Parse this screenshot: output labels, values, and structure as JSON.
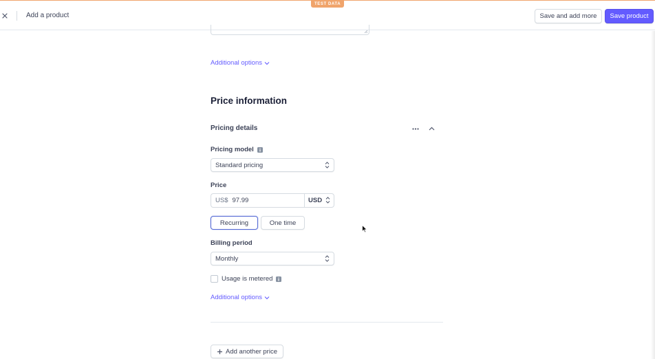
{
  "header": {
    "test_badge": "TEST DATA",
    "title": "Add a product",
    "save_and_add_more": "Save and add more",
    "save_product": "Save product"
  },
  "product_section": {
    "additional_options": "Additional options"
  },
  "price_section": {
    "title": "Price information",
    "pricing_details": "Pricing details",
    "pricing_model_label": "Pricing model",
    "pricing_model_value": "Standard pricing",
    "price_label": "Price",
    "currency_prefix": "US$",
    "price_value": "97.99",
    "currency": "USD",
    "type_options": [
      "Recurring",
      "One time"
    ],
    "selected_type": "Recurring",
    "billing_period_label": "Billing period",
    "billing_period_value": "Monthly",
    "usage_metered_label": "Usage is metered",
    "usage_metered_checked": false,
    "additional_options": "Additional options",
    "add_another_price": "Add another price"
  },
  "colors": {
    "accent": "#635bff",
    "test_badge": "#f0a46b",
    "text": "#3c4257"
  }
}
